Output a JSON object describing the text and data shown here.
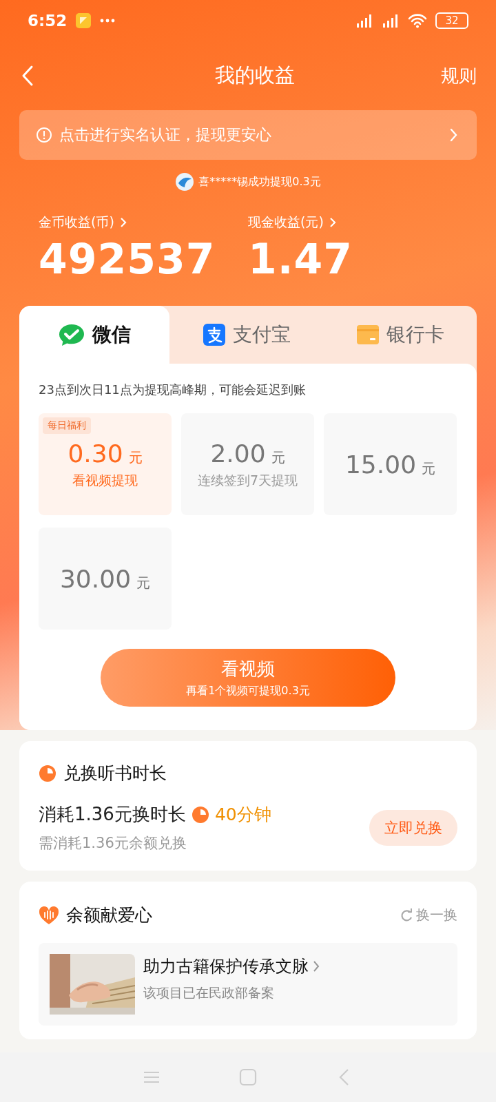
{
  "status_bar": {
    "time": "6:52",
    "battery": "32"
  },
  "header": {
    "title": "我的收益",
    "action": "规则"
  },
  "notice": {
    "text": "点击进行实名认证，提现更安心"
  },
  "ticker": {
    "text": "喜*****锡成功提现0.3元"
  },
  "stats": [
    {
      "label": "金币收益(币)",
      "value": "492537"
    },
    {
      "label": "现金收益(元)",
      "value": "1.47"
    }
  ],
  "withdraw": {
    "tabs": [
      {
        "label": "微信",
        "kind": "wechat",
        "selected": true
      },
      {
        "label": "支付宝",
        "kind": "alipay",
        "selected": false
      },
      {
        "label": "银行卡",
        "kind": "bank",
        "selected": false
      }
    ],
    "hint": "23点到次日11点为提现高峰期，可能会延迟到账",
    "options": [
      {
        "tag": "每日福利",
        "amount": "0.30",
        "unit": "元",
        "caption": "看视频提现",
        "selected": true
      },
      {
        "amount": "2.00",
        "unit": "元",
        "caption": "连续签到7天提现",
        "selected": false
      },
      {
        "amount": "15.00",
        "unit": "元",
        "selected": false
      },
      {
        "amount": "30.00",
        "unit": "元",
        "selected": false
      }
    ],
    "button": {
      "label": "看视频",
      "sublabel": "再看1个视频可提现0.3元"
    }
  },
  "exchange": {
    "title": "兑换听书时长",
    "offer": "消耗1.36元换时长",
    "duration": "40分钟",
    "note": "需消耗1.36元余额兑换",
    "button": "立即兑换"
  },
  "charity": {
    "title": "余额献爱心",
    "refresh": "换一换",
    "project": {
      "title": "助力古籍保护传承文脉",
      "description": "该项目已在民政部备案",
      "kind": "picture"
    }
  }
}
